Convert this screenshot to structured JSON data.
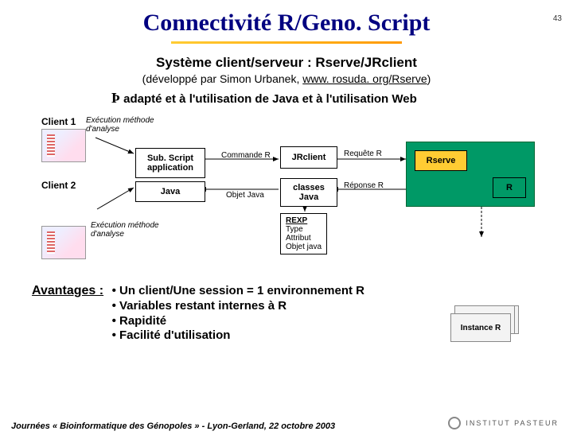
{
  "page_number": "43",
  "title": "Connectivité R/Geno. Script",
  "subtitle": "Système client/serveur : Rserve/JRclient",
  "developed_prefix": "(développé par Simon Urbanek, ",
  "developed_link": "www. rosuda. org/Rserve",
  "developed_suffix": ")",
  "adapt_symbol": "Þ",
  "adapt_text": " adapté et à l'utilisation de Java et à l'utilisation Web",
  "client1": "Client 1",
  "client2": "Client 2",
  "exec_label": "Exécution méthode d'analyse",
  "subscript_box": "Sub. Script application",
  "java_box": "Java",
  "jrclient_box": "JRclient",
  "classes_java_box": "classes Java",
  "rserve_box": "Rserve",
  "r_box": "R",
  "instance_r": "Instance R",
  "flow": {
    "commande_r": "Commande R",
    "objet_java": "Objet Java",
    "requete_r": "Requête R",
    "reponse_r": "Réponse R"
  },
  "rexp": {
    "hdr": "REXP",
    "l1": "Type",
    "l2": "Attribut",
    "l3": "Objet java"
  },
  "advantages_hdr": "Avantages :",
  "advantages": [
    "• Un client/Une session = 1 environnement R",
    "• Variables restant internes à R",
    "• Rapidité",
    "• Facilité d'utilisation"
  ],
  "footer": "Journées « Bioinformatique des Génopoles » - Lyon-Gerland, 22 octobre 2003",
  "logo_text": "INSTITUT PASTEUR"
}
